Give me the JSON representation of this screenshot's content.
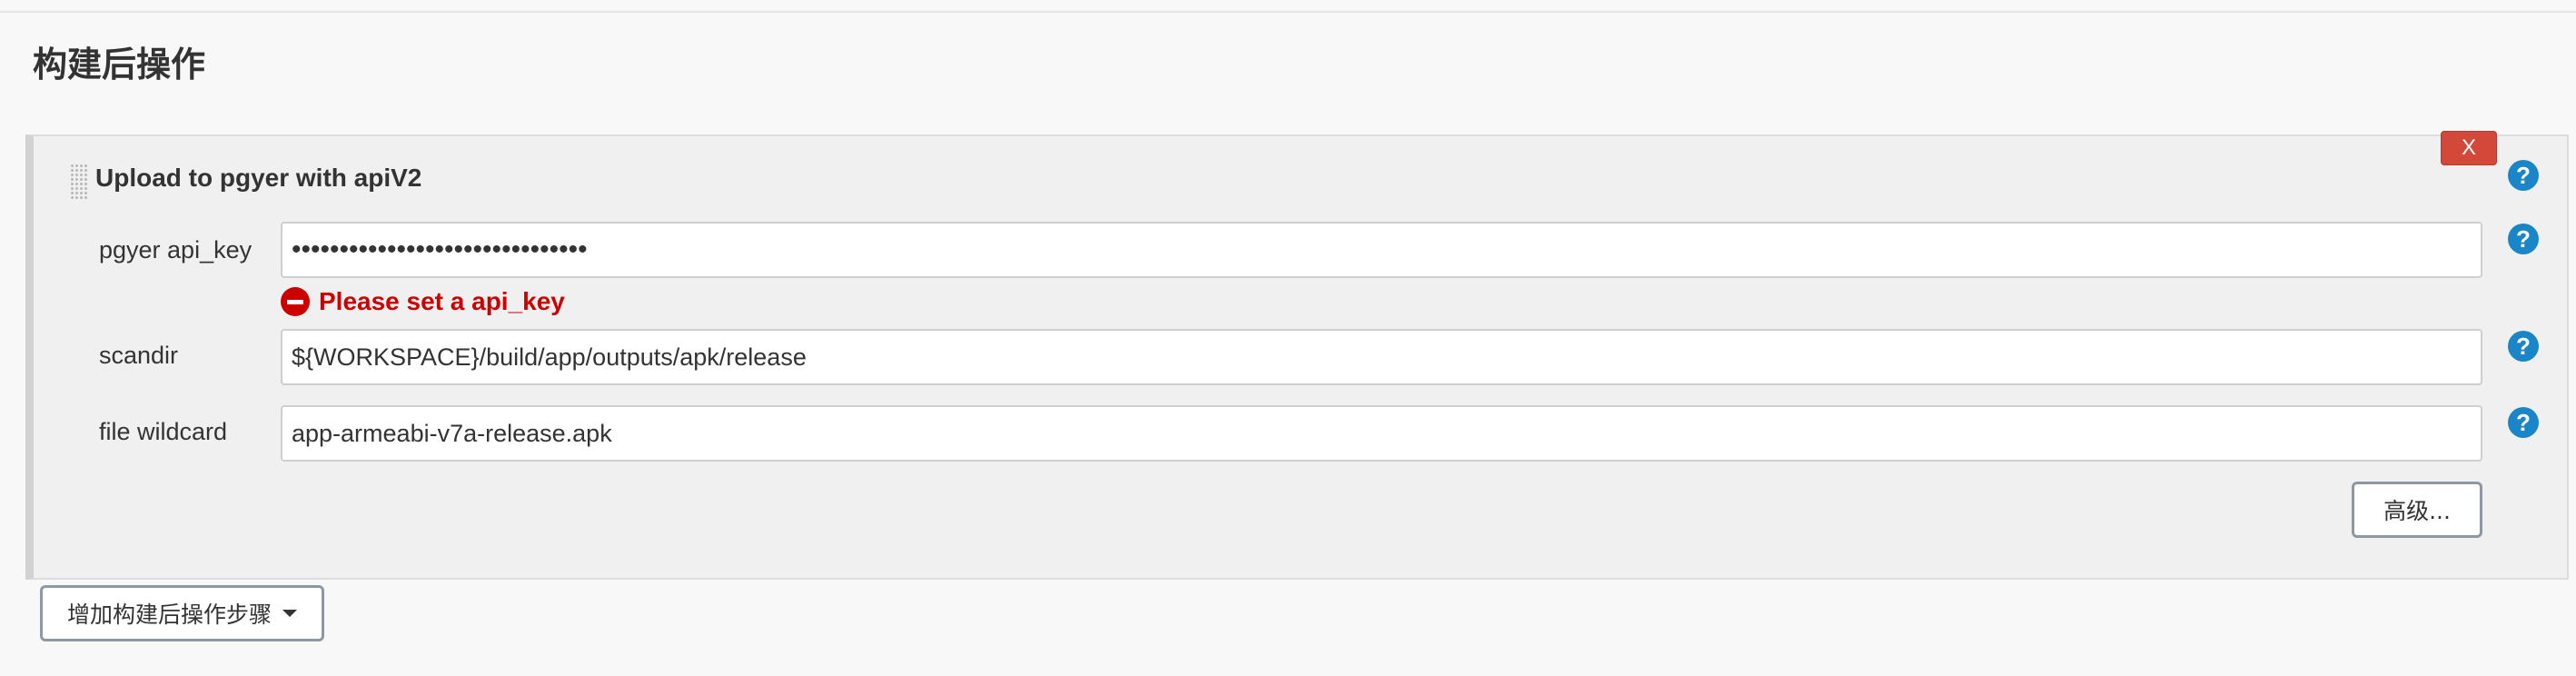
{
  "section": {
    "title": "构建后操作"
  },
  "step": {
    "title": "Upload to pgyer with apiV2",
    "delete_label": "X",
    "help_glyph": "?",
    "fields": {
      "api_key": {
        "label": "pgyer api_key",
        "value": "•••••••••••••••••••••••••••••••",
        "error": "Please set a api_key"
      },
      "scandir": {
        "label": "scandir",
        "value": "${WORKSPACE}/build/app/outputs/apk/release"
      },
      "wildcard": {
        "label": "file wildcard",
        "value": "app-armeabi-v7a-release.apk"
      }
    },
    "advanced_label": "高级..."
  },
  "actions": {
    "add_step_label": "增加构建后操作步骤"
  },
  "icons": {
    "drag": "drag-handle-icon",
    "help": "help-icon",
    "error": "error-icon",
    "caret": "caret-down-icon"
  },
  "colors": {
    "delete_button": "#d24939",
    "help": "#1a86c8",
    "error": "#cc0000",
    "panel": "#f0f0f0",
    "page": "#f8f8f8"
  }
}
